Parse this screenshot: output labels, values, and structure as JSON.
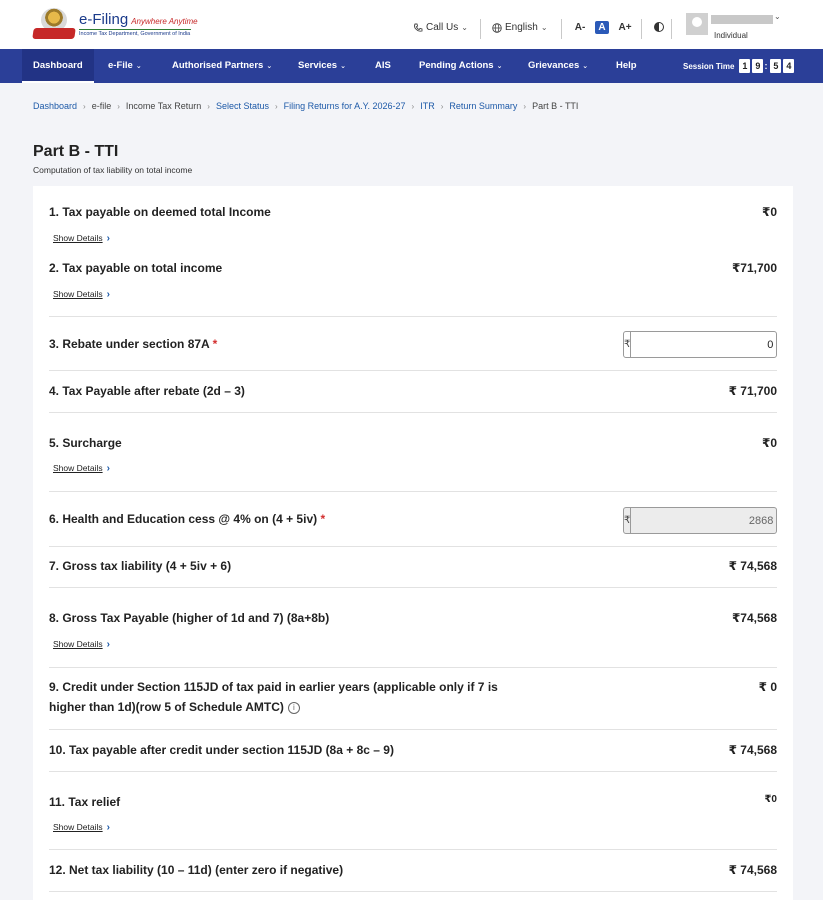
{
  "header": {
    "brand_name": "e-Filing",
    "brand_tagline": "Anywhere Anytime",
    "brand_sub": "Income Tax Department, Government of India",
    "call_us": "Call Us",
    "language": "English",
    "font_decrease": "A-",
    "font_normal": "A",
    "font_increase": "A+",
    "user_role": "Individual"
  },
  "nav": {
    "items": [
      {
        "label": "Dashboard"
      },
      {
        "label": "e-File"
      },
      {
        "label": "Authorised Partners"
      },
      {
        "label": "Services"
      },
      {
        "label": "AIS"
      },
      {
        "label": "Pending Actions"
      },
      {
        "label": "Grievances"
      },
      {
        "label": "Help"
      }
    ],
    "session_label": "Session Time",
    "session_digits": [
      "1",
      "9",
      "5",
      "4"
    ]
  },
  "breadcrumb": [
    "Dashboard",
    "e-file",
    "Income Tax Return",
    "Select Status",
    "Filing Returns for A.Y. 2026-27",
    "ITR",
    "Return Summary",
    "Part B - TTI"
  ],
  "page": {
    "title": "Part B - TTI",
    "subtitle": "Computation of tax liability on total income"
  },
  "show_details_label": "Show Details",
  "rupee": "₹",
  "rows": [
    {
      "label": "1. Tax payable on deemed total Income",
      "value": "₹0"
    },
    {
      "label": "2. Tax payable on total income",
      "value": "₹71,700"
    },
    {
      "label": "3. Rebate under section 87A",
      "input_value": "0"
    },
    {
      "label": "4. Tax Payable after rebate (2d – 3)",
      "value": "₹ 71,700"
    },
    {
      "label": "5. Surcharge",
      "value": "₹0"
    },
    {
      "label": "6. Health and Education cess @ 4% on (4 + 5iv)",
      "input_value": "2868"
    },
    {
      "label": "7. Gross tax liability (4 + 5iv + 6)",
      "value": "₹ 74,568"
    },
    {
      "label": "8. Gross Tax Payable (higher of 1d and 7) (8a+8b)",
      "value": "₹74,568"
    },
    {
      "label_line1": "9. Credit under Section 115JD of tax paid in earlier years (applicable only if 7 is",
      "label_line2": "higher than 1d)(row 5 of Schedule AMTC)",
      "value": "₹ 0"
    },
    {
      "label": "10. Tax payable after credit under section 115JD (8a + 8c – 9)",
      "value": "₹ 74,568"
    },
    {
      "label": "11. Tax relief",
      "value": "₹0"
    },
    {
      "label": "12. Net tax liability (10 – 11d) (enter zero if negative)",
      "value": "₹ 74,568"
    }
  ],
  "required_mark": "*",
  "colors": {
    "nav_bg": "#2b3f98",
    "link": "#1e5aa8",
    "required": "#d32f2f"
  }
}
